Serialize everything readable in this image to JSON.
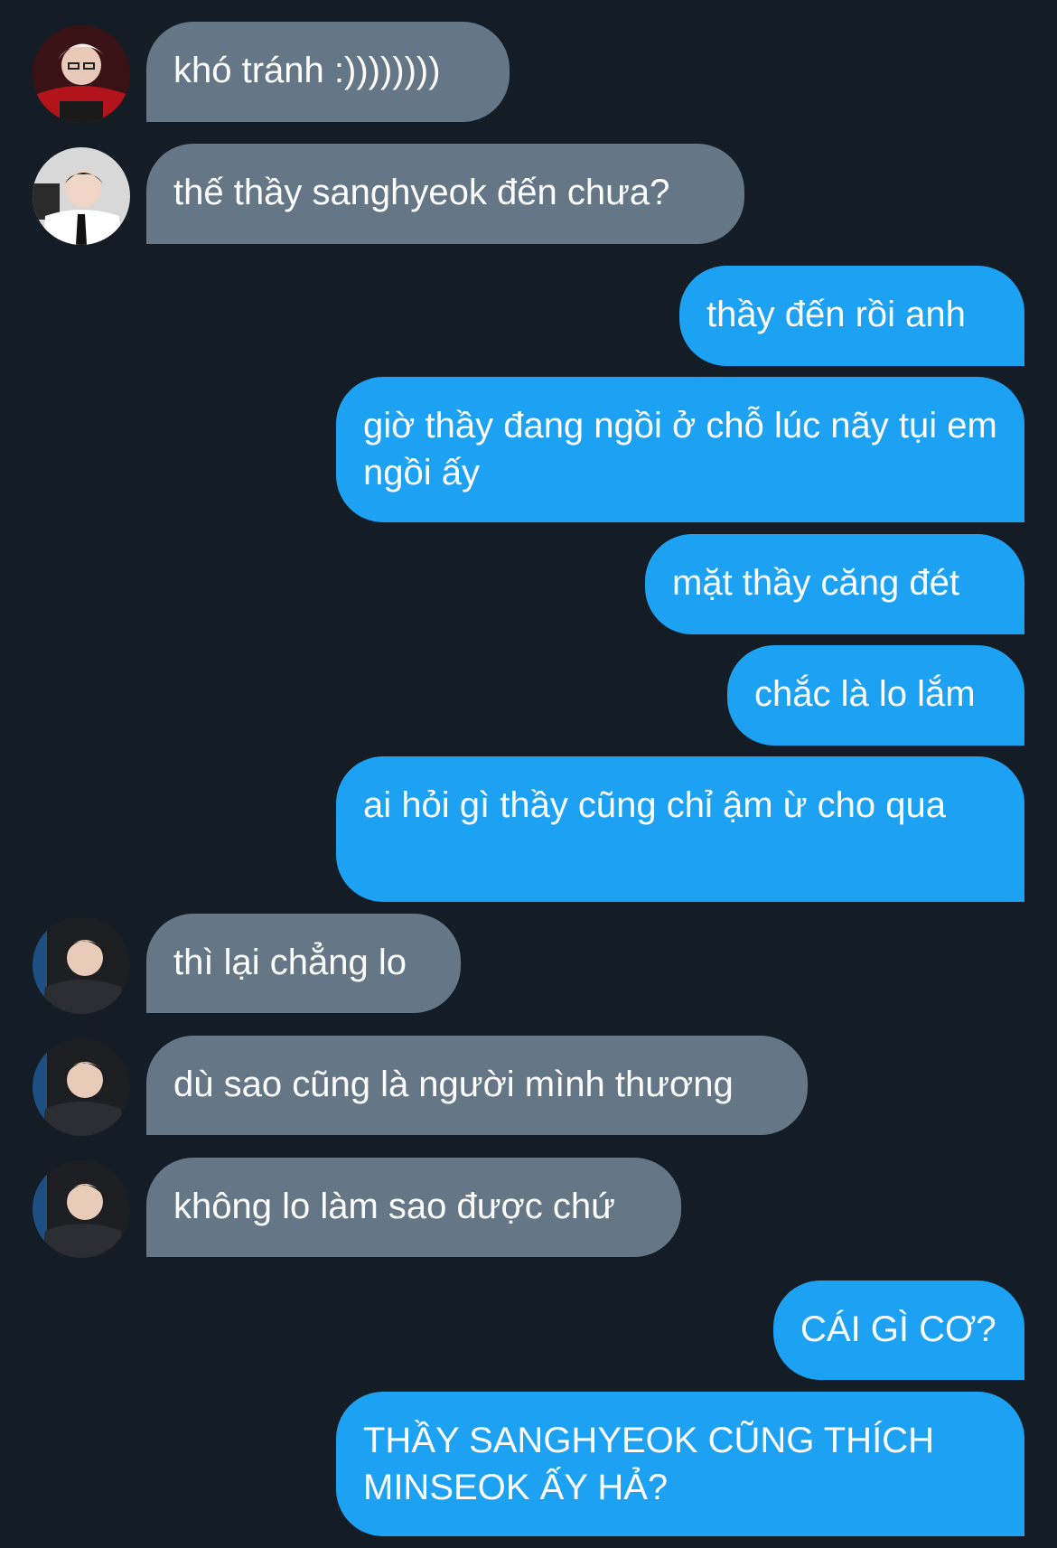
{
  "conversation": {
    "messages": [
      {
        "sender": "other",
        "avatar": "avatar-red-jersey",
        "text": "khó tránh :))))))))"
      },
      {
        "sender": "other",
        "avatar": "avatar-white-shirt-tie",
        "text": "thế thầy sanghyeok đến chưa?"
      },
      {
        "sender": "me",
        "text": "thầy đến rồi anh"
      },
      {
        "sender": "me",
        "text": "giờ thầy đang ngồi ở chỗ lúc nãy tụi em ngồi ấy"
      },
      {
        "sender": "me",
        "text": "mặt thầy căng đét"
      },
      {
        "sender": "me",
        "text": "chắc là lo lắm"
      },
      {
        "sender": "me",
        "text": "ai hỏi gì thầy cũng chỉ ậm ừ cho qua"
      },
      {
        "sender": "other",
        "avatar": "avatar-dark-suit",
        "text": "thì lại chẳng lo"
      },
      {
        "sender": "other",
        "avatar": "avatar-dark-suit",
        "text": "dù sao cũng là người mình thương"
      },
      {
        "sender": "other",
        "avatar": "avatar-dark-suit",
        "text": "không lo làm sao được chứ"
      },
      {
        "sender": "me",
        "text": "CÁI GÌ CƠ?"
      },
      {
        "sender": "me",
        "text": "THẦY SANGHYEOK CŨNG THÍCH MINSEOK ẤY HẢ?"
      }
    ]
  },
  "colors": {
    "background": "#141d26",
    "incoming_bubble": "#657786",
    "outgoing_bubble": "#1da1f2",
    "text": "#ffffff"
  }
}
